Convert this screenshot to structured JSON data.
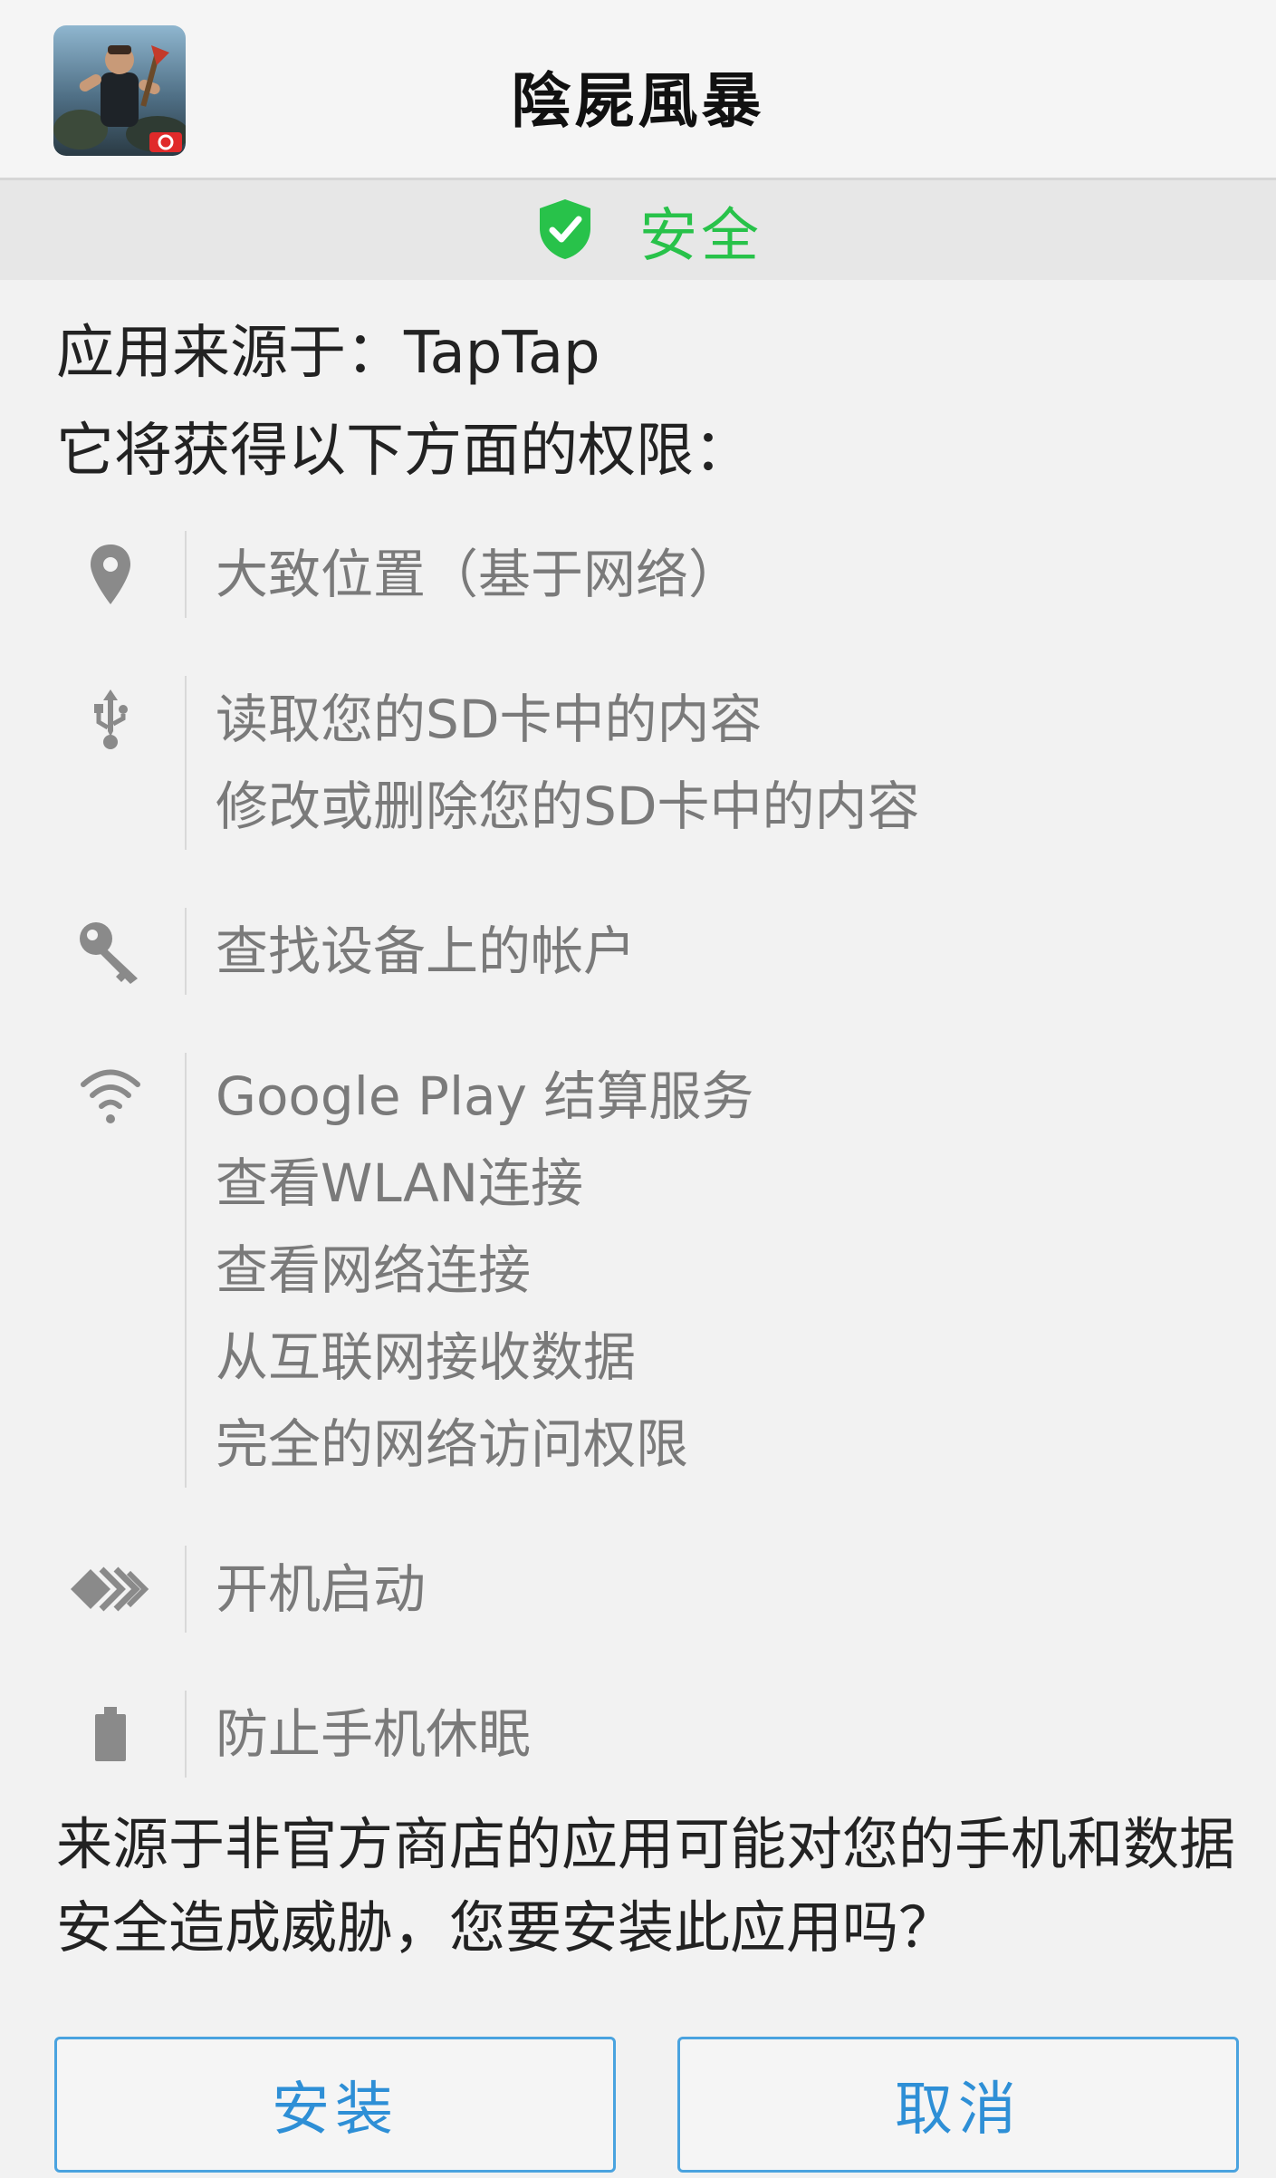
{
  "header": {
    "app_title": "陰屍風暴",
    "app_icon": "game-app-icon"
  },
  "safety": {
    "label": "安全",
    "icon": "shield-check-icon",
    "color": "#28c24a"
  },
  "source": {
    "text": "应用来源于：TapTap"
  },
  "permissions": {
    "heading": "它将获得以下方面的权限：",
    "groups": [
      {
        "icon": "location-pin-icon",
        "lines": [
          "大致位置（基于网络）"
        ]
      },
      {
        "icon": "usb-icon",
        "lines": [
          "读取您的SD卡中的内容",
          "修改或删除您的SD卡中的内容"
        ]
      },
      {
        "icon": "key-icon",
        "lines": [
          "查找设备上的帐户"
        ]
      },
      {
        "icon": "wifi-icon",
        "lines": [
          "Google Play 结算服务",
          "查看WLAN连接",
          "查看网络连接",
          "从互联网接收数据",
          "完全的网络访问权限"
        ]
      },
      {
        "icon": "startup-arrows-icon",
        "lines": [
          "开机启动"
        ]
      },
      {
        "icon": "battery-icon",
        "lines": [
          "防止手机休眠"
        ]
      }
    ]
  },
  "warning": {
    "text": "来源于非官方商店的应用可能对您的手机和数据安全造成威胁，您要安装此应用吗？"
  },
  "buttons": {
    "install": "安装",
    "cancel": "取消",
    "accent": "#2e8fd6"
  }
}
